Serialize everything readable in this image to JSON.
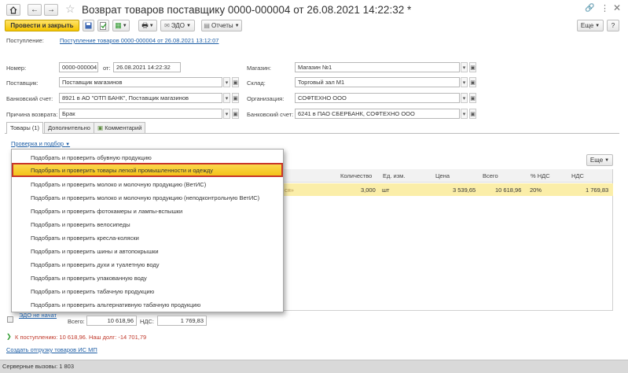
{
  "header": {
    "title": "Возврат товаров поставщику 0000-000004 от 26.08.2021 14:22:32 *",
    "link_icon": "link-icon",
    "more_icon": "kebab-icon",
    "close_icon": "close-icon"
  },
  "toolbar": {
    "post_and_close": "Провести и закрыть",
    "edo": "ЭДО",
    "reports": "Отчеты",
    "more": "Еще",
    "help": "?"
  },
  "basis": {
    "label": "Поступление:",
    "value": "Поступление товаров 0000-000004 от 26.08.2021 13:12:07"
  },
  "form": {
    "number_label": "Номер:",
    "number_value": "0000-000004",
    "date_label": "от:",
    "date_value": "26.08.2021 14:22:32",
    "supplier_label": "Поставщик:",
    "supplier_value": "Поставщик магазинов",
    "bank_label": "Банковский счет:",
    "bank_value": "8921 в АО \"ОТП БАНК\", Поставщик магазинов",
    "reason_label": "Причина возврата:",
    "reason_value": "Брак",
    "store_label": "Магазин:",
    "store_value": "Магазин №1",
    "warehouse_label": "Склад:",
    "warehouse_value": "Торговый зал М1",
    "org_label": "Организация:",
    "org_value": "СОФТЕХНО ООО",
    "bank2_label": "Банковский счет:",
    "bank2_value": "6241 в ПАО СБЕРБАНК, СОФТЕХНО ООО"
  },
  "tabs": [
    {
      "label": "Товары (1)"
    },
    {
      "label": "Дополнительно"
    },
    {
      "label": "Комментарий"
    }
  ],
  "check_menu": {
    "trigger": "Проверка и подбор",
    "items": [
      "Подобрать и проверить обувную продукцию",
      "Подобрать и проверить товары легкой промышленности и одежду",
      "Подобрать и проверить молоко и молочную продукцию (ВетИС)",
      "Подобрать и проверить молоко и молочную продукцию (неподконтрольную ВетИС)",
      "Подобрать и проверить фотокамеры и лампы-вспышки",
      "Подобрать и проверить велосипеды",
      "Подобрать и проверить кресла-коляски",
      "Подобрать и проверить шины и автопокрышки",
      "Подобрать и проверить духи и туалетную воду",
      "Подобрать и проверить упакованную воду",
      "Подобрать и проверить табачную продукцию",
      "Подобрать и проверить альтернативную табачную продукцию"
    ],
    "highlighted_index": 1
  },
  "grid": {
    "more": "Еще",
    "columns": [
      "Количество",
      "Ед. изм.",
      "Цена",
      "Всего",
      "% НДС",
      "НДС"
    ],
    "row": {
      "trail": "ся»",
      "qty": "3,000",
      "unit": "шт",
      "price": "3 539,65",
      "total": "10 618,96",
      "vat_rate": "20%",
      "vat": "1 769,83"
    }
  },
  "footer": {
    "edo_status": "ЭДО не начат",
    "total_label": "Всего:",
    "total_value": "10 618,96",
    "vat_label": "НДС:",
    "vat_value": "1 769,83",
    "receipt_info": "К поступлению: 10 618,96. Наш долг: -14 701,79",
    "create_link": "Создать отгрузку товаров ИС МП"
  },
  "status_bar": {
    "text": "Серверные вызовы: 1 803"
  },
  "colors": {
    "accent_yellow": "#f5c400",
    "highlight_border": "#c8362b",
    "link_blue": "#1f5fa6",
    "row_selected": "#fbeea9"
  }
}
